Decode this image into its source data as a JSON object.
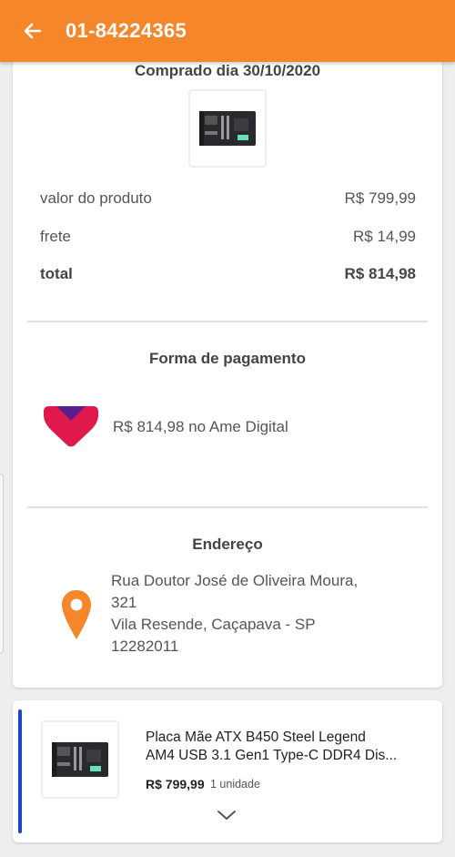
{
  "header": {
    "title": "01-84224365",
    "back_icon": "arrow-left-icon",
    "color": "#f5862a"
  },
  "summary": {
    "purchased_label": "Comprado dia 30/10/2020",
    "rows": [
      {
        "label": "valor do produto",
        "value": "R$ 799,99"
      },
      {
        "label": "frete",
        "value": "R$ 14,99"
      },
      {
        "label": "total",
        "value": "R$ 814,98"
      }
    ]
  },
  "payment": {
    "title": "Forma de pagamento",
    "text": "R$ 814,98 no Ame Digital",
    "logo_icon": "ame-digital-logo",
    "logo_colors": [
      "#e0194d",
      "#5a1f8c"
    ]
  },
  "address": {
    "title": "Endereço",
    "line1": "Rua Doutor José de Oliveira Moura,",
    "line2": "321",
    "line3": "Vila Resende, Caçapava - SP",
    "line4": "12282011",
    "icon": "location-pin-icon",
    "icon_color": "#f5862a"
  },
  "item": {
    "name_line1": "Placa Mãe ATX B450 Steel Legend",
    "name_line2": "AM4 USB 3.1 Gen1 Type-C DDR4 Dis...",
    "price": "R$ 799,99",
    "quantity": "1 unidade",
    "accent_color": "#1a46c8",
    "expand_icon": "chevron-down-icon"
  }
}
